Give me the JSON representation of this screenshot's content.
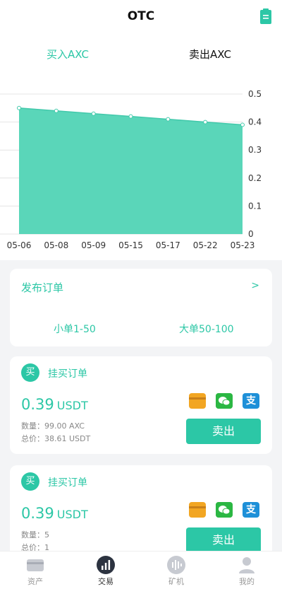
{
  "header": {
    "title": "OTC"
  },
  "tabs": {
    "buy": "买入AXC",
    "sell": "卖出AXC"
  },
  "chart_data": {
    "type": "area",
    "categories": [
      "05-06",
      "05-08",
      "05-09",
      "05-15",
      "05-17",
      "05-22",
      "05-23"
    ],
    "values": [
      0.45,
      0.44,
      0.43,
      0.42,
      0.41,
      0.4,
      0.39
    ],
    "ylim": [
      0,
      0.5
    ],
    "yticks": [
      "0",
      "0.1",
      "0.2",
      "0.3",
      "0.4",
      "0.5"
    ],
    "color": "#5ad6b9",
    "grid": true
  },
  "publish": {
    "title": "发布订单",
    "arrow": ">",
    "small": "小单1-50",
    "large": "大单50-100"
  },
  "orders": [
    {
      "badge": "买",
      "type": "挂买订单",
      "price": "0.39",
      "unit": "USDT",
      "qty": "数量：99.00 AXC",
      "total": "总价：38.61 USDT",
      "button": "卖出"
    },
    {
      "badge": "买",
      "type": "挂买订单",
      "price": "0.39",
      "unit": "USDT",
      "qty": "数量：5",
      "total": "总价：1",
      "button": "卖出"
    }
  ],
  "tabbar": {
    "assets": "资产",
    "trade": "交易",
    "miner": "矿机",
    "mine": "我的"
  },
  "colors": {
    "accent": "#2cc7a6"
  }
}
